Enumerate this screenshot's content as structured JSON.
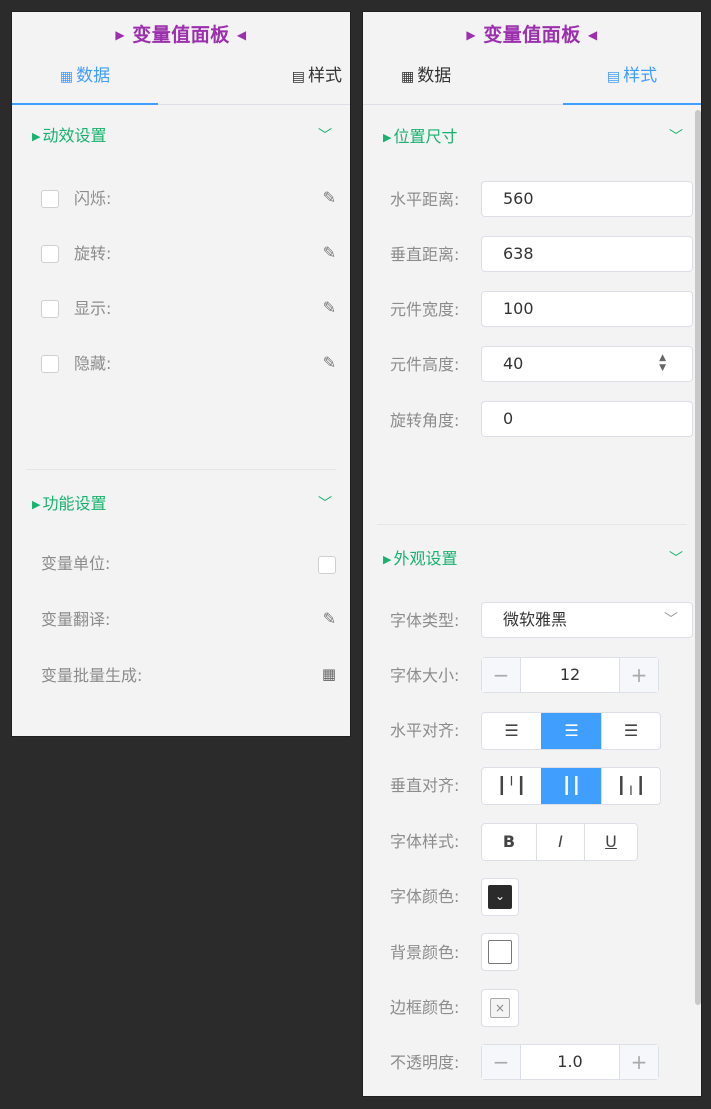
{
  "left": {
    "title": "变量值面板",
    "tabs": {
      "data": "数据",
      "style": "样式"
    },
    "anim": {
      "title": "动效设置",
      "items": [
        {
          "label": "闪烁:"
        },
        {
          "label": "旋转:"
        },
        {
          "label": "显示:"
        },
        {
          "label": "隐藏:"
        }
      ]
    },
    "func": {
      "title": "功能设置",
      "unit": "变量单位:",
      "translate": "变量翻译:",
      "batch": "变量批量生成:"
    }
  },
  "right": {
    "title": "变量值面板",
    "tabs": {
      "data": "数据",
      "style": "样式"
    },
    "pos": {
      "title": "位置尺寸",
      "h_label": "水平距离:",
      "h_value": "560",
      "v_label": "垂直距离:",
      "v_value": "638",
      "w_label": "元件宽度:",
      "w_value": "100",
      "ht_label": "元件高度:",
      "ht_value": "40",
      "rot_label": "旋转角度:",
      "rot_value": "0"
    },
    "look": {
      "title": "外观设置",
      "font_type_label": "字体类型:",
      "font_type_value": "微软雅黑",
      "font_size_label": "字体大小:",
      "font_size_value": "12",
      "halign_label": "水平对齐:",
      "valign_label": "垂直对齐:",
      "fstyle_label": "字体样式:",
      "bold": "B",
      "italic": "I",
      "underline": "U",
      "font_color_label": "字体颜色:",
      "font_color": "#2b2b2b",
      "bg_color_label": "背景颜色:",
      "bg_color": "#ffffff",
      "border_color_label": "边框颜色:",
      "opacity_label": "不透明度:",
      "opacity_value": "1.0"
    }
  }
}
